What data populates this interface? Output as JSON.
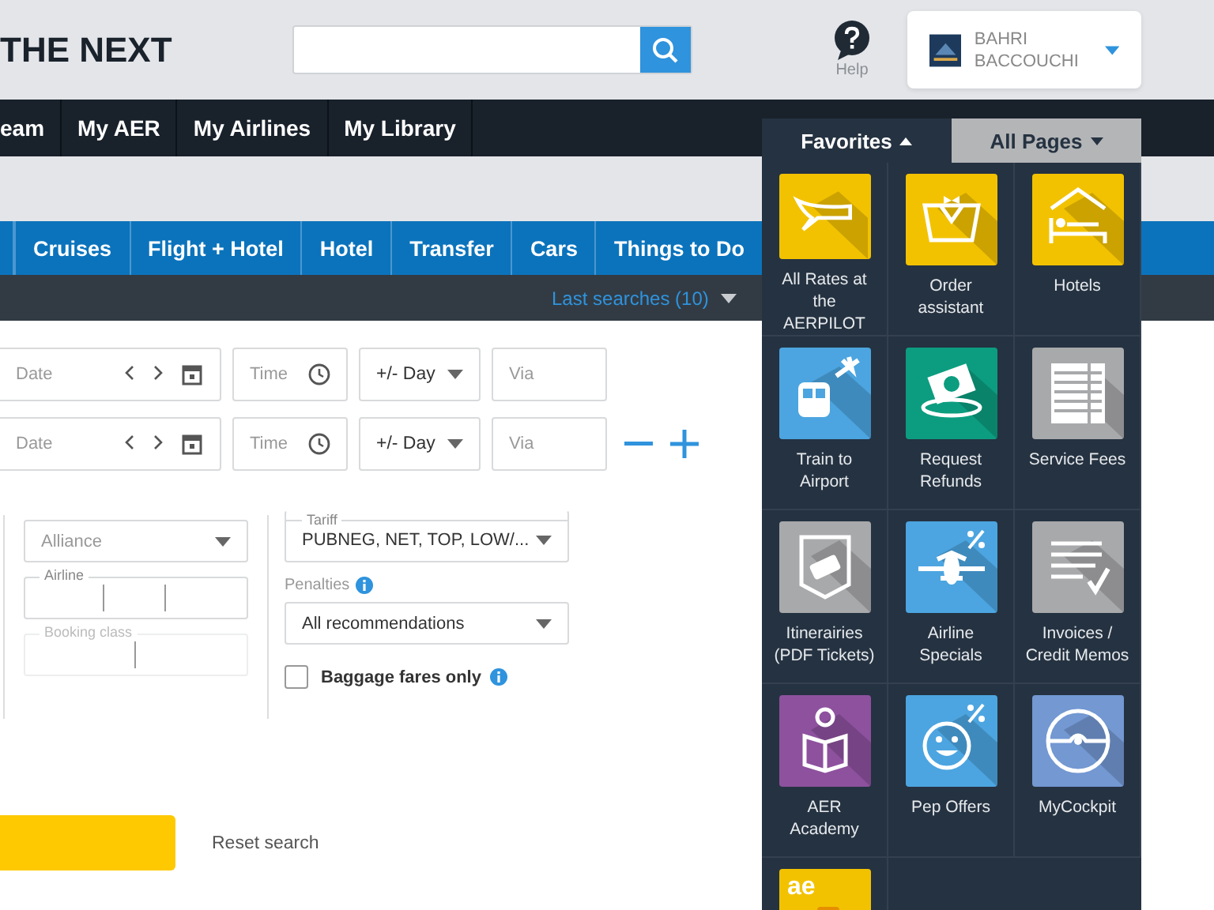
{
  "header": {
    "logo": "THE NEXT",
    "help": "Help",
    "user": "BAHRI BACCOUCHI"
  },
  "nav": [
    "eam",
    "My AER",
    "My Airlines",
    "My Library"
  ],
  "tabs": [
    {
      "label": "Cruises",
      "selected": false
    },
    {
      "label": "Flight + Hotel",
      "selected": false
    },
    {
      "label": "Hotel",
      "selected": false
    },
    {
      "label": "Transfer",
      "selected": false
    },
    {
      "label": "Cars",
      "selected": false
    },
    {
      "label": "Things to Do",
      "selected": false
    }
  ],
  "last_searches": "Last searches (10)",
  "routes": [
    {
      "date": "Date",
      "time": "Time",
      "day": "+/- Day",
      "via": "Via",
      "add_remove": false
    },
    {
      "date": "Date",
      "time": "Time",
      "day": "+/- Day",
      "via": "Via",
      "add_remove": true
    }
  ],
  "filters": {
    "alliance": "Alliance",
    "airline": "Airline",
    "booking_class": "Booking class",
    "booking_disabled": true,
    "tariff_label": "Tariff",
    "tariff": "PUBNEG, NET, TOP, LOW/...",
    "penalties_label": "Penalties",
    "penalties": "All recommendations",
    "baggage": {
      "label": "Baggage fares only",
      "checked": false
    }
  },
  "reset": "Reset search",
  "menu": {
    "tabs": [
      {
        "label": "Favorites",
        "selected": true
      },
      {
        "label": "All Pages",
        "selected": false
      }
    ],
    "tiles": [
      {
        "kind": "app",
        "label": "All Rates at the AERPILOT",
        "color": "#f2c200"
      },
      {
        "kind": "app",
        "label": "Order assistant",
        "color": "#f2c200"
      },
      {
        "kind": "app",
        "label": "Hotels",
        "color": "#f2c200"
      },
      {
        "kind": "app",
        "label": "Train to Airport",
        "color": "#4ca5e0"
      },
      {
        "kind": "app",
        "label": "Request Refunds",
        "color": "#0c9d80"
      },
      {
        "kind": "app",
        "label": "Service Fees",
        "color": "#a8a9ab"
      },
      {
        "kind": "app",
        "label": "Itinerairies (PDF Tickets)",
        "color": "#a8a9ab"
      },
      {
        "kind": "app",
        "label": "Airline Specials",
        "color": "#4ca5e0"
      },
      {
        "kind": "app",
        "label": "Invoices / Credit Memos",
        "color": "#a8a9ab"
      },
      {
        "kind": "app",
        "label": "AER Academy",
        "color": "#8d519e"
      },
      {
        "kind": "app",
        "label": "Pep Offers",
        "color": "#4ca5e0"
      },
      {
        "kind": "app",
        "label": "MyCockpit",
        "color": "#7398d2"
      },
      {
        "kind": "logo",
        "logo_text": "ae",
        "color": "#f2c200"
      }
    ]
  }
}
